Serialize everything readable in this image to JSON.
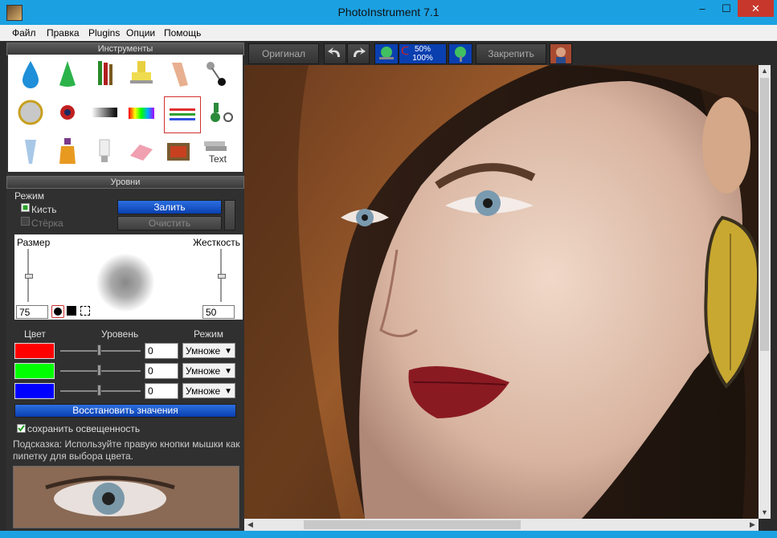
{
  "window": {
    "title": "PhotoInstrument 7.1",
    "min": "–",
    "max": "☐",
    "close": "✕"
  },
  "menu": [
    "Файл",
    "Правка",
    "Plugins",
    "Опции",
    "Помощь"
  ],
  "tools_panel": {
    "title": "Инструменты",
    "text_tool_label": "Text"
  },
  "levels_panel": {
    "title": "Уровни",
    "mode_label": "Режим",
    "brush_option": "Кисть",
    "eraser_option": "Стёрка",
    "fill_button": "Залить",
    "clear_button": "Очистить",
    "size_label": "Размер",
    "hardness_label": "Жесткость",
    "size_value": "75",
    "hardness_value": "50",
    "col_color": "Цвет",
    "col_level": "Уровень",
    "col_mode": "Режим",
    "rows": [
      {
        "color": "#ff0000",
        "value": "0",
        "mode": "Умноже"
      },
      {
        "color": "#00ff00",
        "value": "0",
        "mode": "Умноже"
      },
      {
        "color": "#0000ff",
        "value": "0",
        "mode": "Умноже"
      }
    ],
    "restore_button": "Восстановить значения",
    "preserve_label": "сохранить освещенность",
    "hint": "Подсказка: Используйте правую кнопки мышки как пипетку для выбора цвета."
  },
  "toolbar": {
    "original_button": "Оригинал",
    "zoom_top": "50%",
    "zoom_bottom": "100%",
    "commit_button": "Закрепить"
  },
  "colors": {
    "titlebar": "#1ba1e2",
    "accent_blue": "#0a3fb0",
    "panel": "#303030"
  }
}
